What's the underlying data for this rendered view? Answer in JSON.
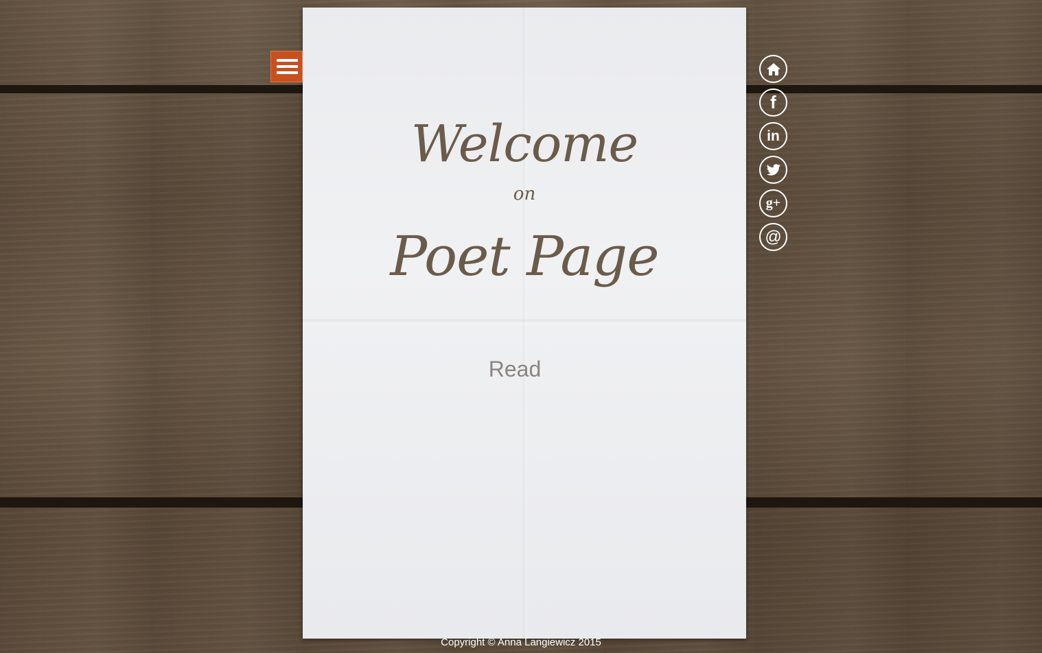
{
  "menu": {
    "icon": "hamburger-menu-icon"
  },
  "hero": {
    "title_line1": "Welcome",
    "title_line2": "on",
    "title_line3": "Poet Page",
    "read_label": "Read"
  },
  "social": {
    "items": [
      {
        "icon": "home-icon"
      },
      {
        "icon": "facebook-icon",
        "glyph": "f"
      },
      {
        "icon": "linkedin-icon",
        "glyph": "in"
      },
      {
        "icon": "twitter-icon"
      },
      {
        "icon": "google-plus-icon",
        "glyph": "g+"
      },
      {
        "icon": "email-icon",
        "glyph": "@"
      }
    ]
  },
  "footer": {
    "copyright": "Copyright © Anna Langiewicz 2015"
  },
  "colors": {
    "accent": "#c8501f",
    "title_text": "#6b5b4a",
    "link_text": "#8a8580",
    "paper": "#eeeff1"
  }
}
